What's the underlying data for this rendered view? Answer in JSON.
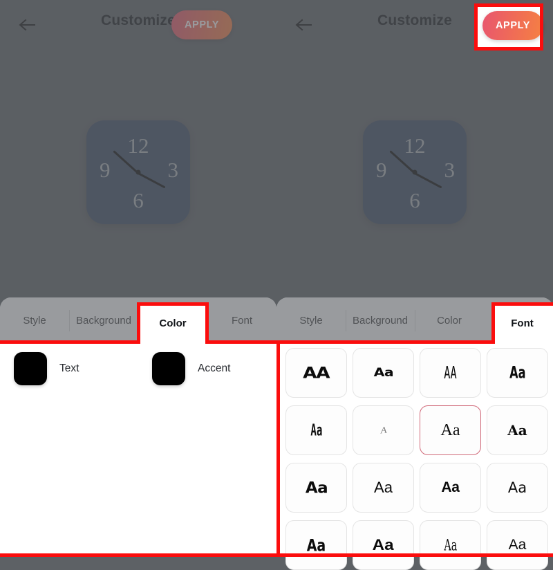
{
  "app": {
    "title": "Customize",
    "back_icon": "arrow-left-icon",
    "apply_label": "APPLY",
    "accent_gradient_start": "#e8566f",
    "accent_gradient_end": "#f58142",
    "background_color": "#5d6165",
    "annotation_color": "#fb0d0d"
  },
  "widget": {
    "type": "analog-clock",
    "background_color": "#3c4a63",
    "numeral_color": "#aab0b4",
    "hand_color": "#0a0a0a",
    "numerals": [
      "12",
      "3",
      "6",
      "9"
    ],
    "hour_hand_angle": 222,
    "minute_hand_angle": 28
  },
  "tabs": [
    {
      "label": "Style"
    },
    {
      "label": "Background"
    },
    {
      "label": "Color"
    },
    {
      "label": "Font"
    }
  ],
  "left_panel": {
    "selected_tab": "Color",
    "selected_tab_index": 2,
    "dimmed": true,
    "color_options": [
      {
        "label": "Text",
        "value": "#000000"
      },
      {
        "label": "Accent",
        "value": "#000000"
      }
    ]
  },
  "right_panel": {
    "selected_tab": "Font",
    "selected_tab_index": 3,
    "dimmed": true,
    "selected_font_index": 6,
    "font_samples": [
      {
        "sample": "AA"
      },
      {
        "sample": "Aa"
      },
      {
        "sample": "AA"
      },
      {
        "sample": "Aa"
      },
      {
        "sample": "Aa"
      },
      {
        "sample": "A"
      },
      {
        "sample": "Aa"
      },
      {
        "sample": "Aa"
      },
      {
        "sample": "Aa"
      },
      {
        "sample": "Aa"
      },
      {
        "sample": "Aa"
      },
      {
        "sample": "Aa"
      },
      {
        "sample": "Aa"
      },
      {
        "sample": "Aa"
      },
      {
        "sample": "Aa"
      },
      {
        "sample": "Aa"
      }
    ]
  }
}
